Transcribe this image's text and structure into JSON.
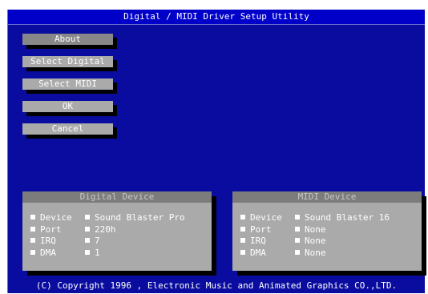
{
  "window": {
    "title": "Digital / MIDI Driver Setup Utility"
  },
  "buttons": {
    "about": "About",
    "select_digital": "Select Digital",
    "select_midi": "Select MIDI",
    "ok": "OK",
    "cancel": "Cancel"
  },
  "digital_panel": {
    "title": "Digital Device",
    "rows": [
      {
        "label": "Device",
        "value": "Sound Blaster Pro"
      },
      {
        "label": "Port",
        "value": "220h"
      },
      {
        "label": "IRQ",
        "value": "7"
      },
      {
        "label": "DMA",
        "value": "1"
      }
    ]
  },
  "midi_panel": {
    "title": "MIDI Device",
    "rows": [
      {
        "label": "Device",
        "value": "Sound Blaster 16"
      },
      {
        "label": "Port",
        "value": "None"
      },
      {
        "label": "IRQ",
        "value": "None"
      },
      {
        "label": "DMA",
        "value": "None"
      }
    ]
  },
  "footer": {
    "copyright": "(C) Copyright 1996 , Electronic Music and Animated Graphics CO.,LTD."
  },
  "colors": {
    "screen_bg": "#0a0ca0",
    "title_bg": "#0000c8",
    "button_face": "#aaaaaa",
    "panel_header": "#7c7c7c"
  }
}
